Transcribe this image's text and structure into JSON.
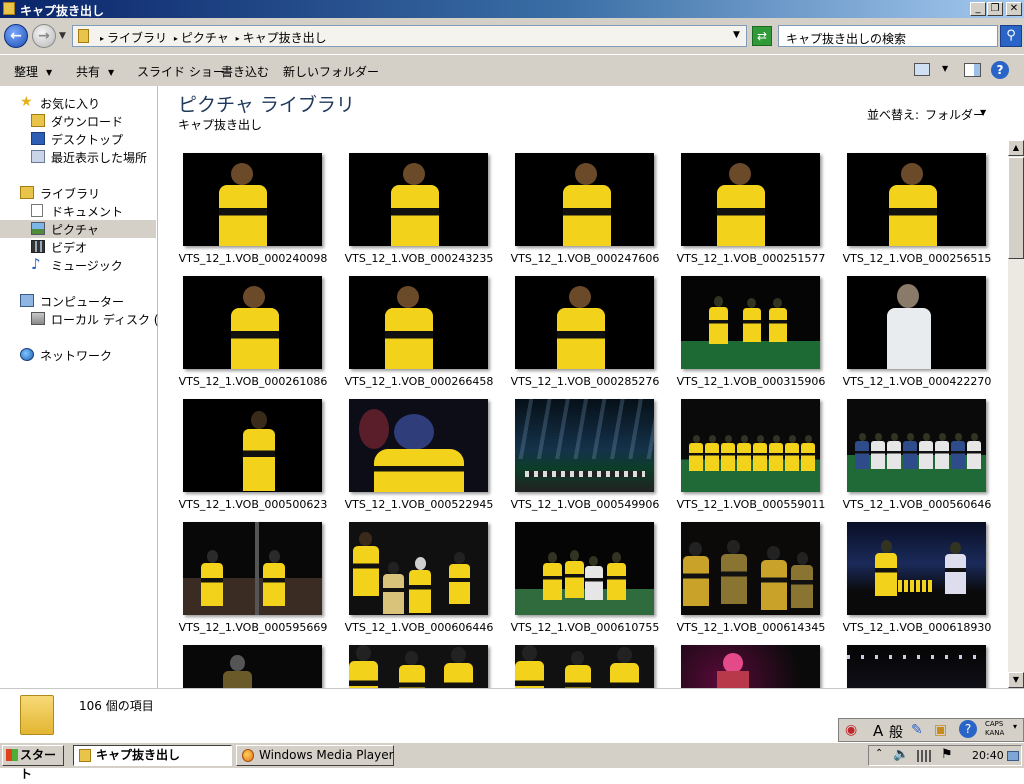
{
  "window": {
    "title": "キャプ抜き出し"
  },
  "address": {
    "crumbs": [
      "ライブラリ",
      "ピクチャ",
      "キャプ抜き出し"
    ],
    "search_placeholder": "キャプ抜き出しの検索"
  },
  "toolbar": {
    "organize": "整理",
    "share": "共有",
    "slideshow": "スライド ショー",
    "burn": "書き込む",
    "new_folder": "新しいフォルダー"
  },
  "nav": {
    "favorites": "お気に入り",
    "downloads": "ダウンロード",
    "desktop": "デスクトップ",
    "recent": "最近表示した場所",
    "libraries": "ライブラリ",
    "documents": "ドキュメント",
    "pictures": "ピクチャ",
    "videos": "ビデオ",
    "music": "ミュージック",
    "computer": "コンピューター",
    "local_disk": "ローカル ディスク (C:)",
    "network": "ネットワーク"
  },
  "content": {
    "title": "ピクチャ ライブラリ",
    "subtitle": "キャプ抜き出し",
    "sort_label": "並べ替え:",
    "sort_value": "フォルダー",
    "files": [
      {
        "name": "VTS_12_1.VOB_000240098",
        "scene": "solo"
      },
      {
        "name": "VTS_12_1.VOB_000243235",
        "scene": "solo"
      },
      {
        "name": "VTS_12_1.VOB_000247606",
        "scene": "solo"
      },
      {
        "name": "VTS_12_1.VOB_000251577",
        "scene": "solo"
      },
      {
        "name": "VTS_12_1.VOB_000256515",
        "scene": "solo"
      },
      {
        "name": "VTS_12_1.VOB_000261086",
        "scene": "solo"
      },
      {
        "name": "VTS_12_1.VOB_000266458",
        "scene": "solo"
      },
      {
        "name": "VTS_12_1.VOB_000285276",
        "scene": "solo"
      },
      {
        "name": "VTS_12_1.VOB_000315906",
        "scene": "trio"
      },
      {
        "name": "VTS_12_1.VOB_000422270",
        "scene": "white"
      },
      {
        "name": "VTS_12_1.VOB_000500623",
        "scene": "solo-far"
      },
      {
        "name": "VTS_12_1.VOB_000522945",
        "scene": "closeup"
      },
      {
        "name": "VTS_12_1.VOB_000549906",
        "scene": "stage"
      },
      {
        "name": "VTS_12_1.VOB_000559011",
        "scene": "line-yellow"
      },
      {
        "name": "VTS_12_1.VOB_000560646",
        "scene": "line-white"
      },
      {
        "name": "VTS_12_1.VOB_000595669",
        "scene": "sitting"
      },
      {
        "name": "VTS_12_1.VOB_000606446",
        "scene": "crowd"
      },
      {
        "name": "VTS_12_1.VOB_000610755",
        "scene": "group"
      },
      {
        "name": "VTS_12_1.VOB_000614345",
        "scene": "crowd-dark"
      },
      {
        "name": "VTS_12_1.VOB_000618930",
        "scene": "wide-blue"
      },
      {
        "name": "",
        "scene": "partial-dark"
      },
      {
        "name": "",
        "scene": "partial-crowd"
      },
      {
        "name": "",
        "scene": "partial-crowd"
      },
      {
        "name": "",
        "scene": "partial-pink"
      },
      {
        "name": "",
        "scene": "partial-stage"
      }
    ]
  },
  "details": {
    "count": "106 個の項目"
  },
  "langbar": {
    "ime_a": "A",
    "ime_mode": "般",
    "caps": "CAPS",
    "kana": "KANA"
  },
  "taskbar": {
    "start": "スタート",
    "task_explorer": "キャプ抜き出し",
    "task_wmp": "Windows Media Player",
    "clock": "20:40"
  },
  "colors": {
    "jersey": "#f2d21a",
    "stripe": "#111111",
    "title_bar": "#0a246a"
  }
}
